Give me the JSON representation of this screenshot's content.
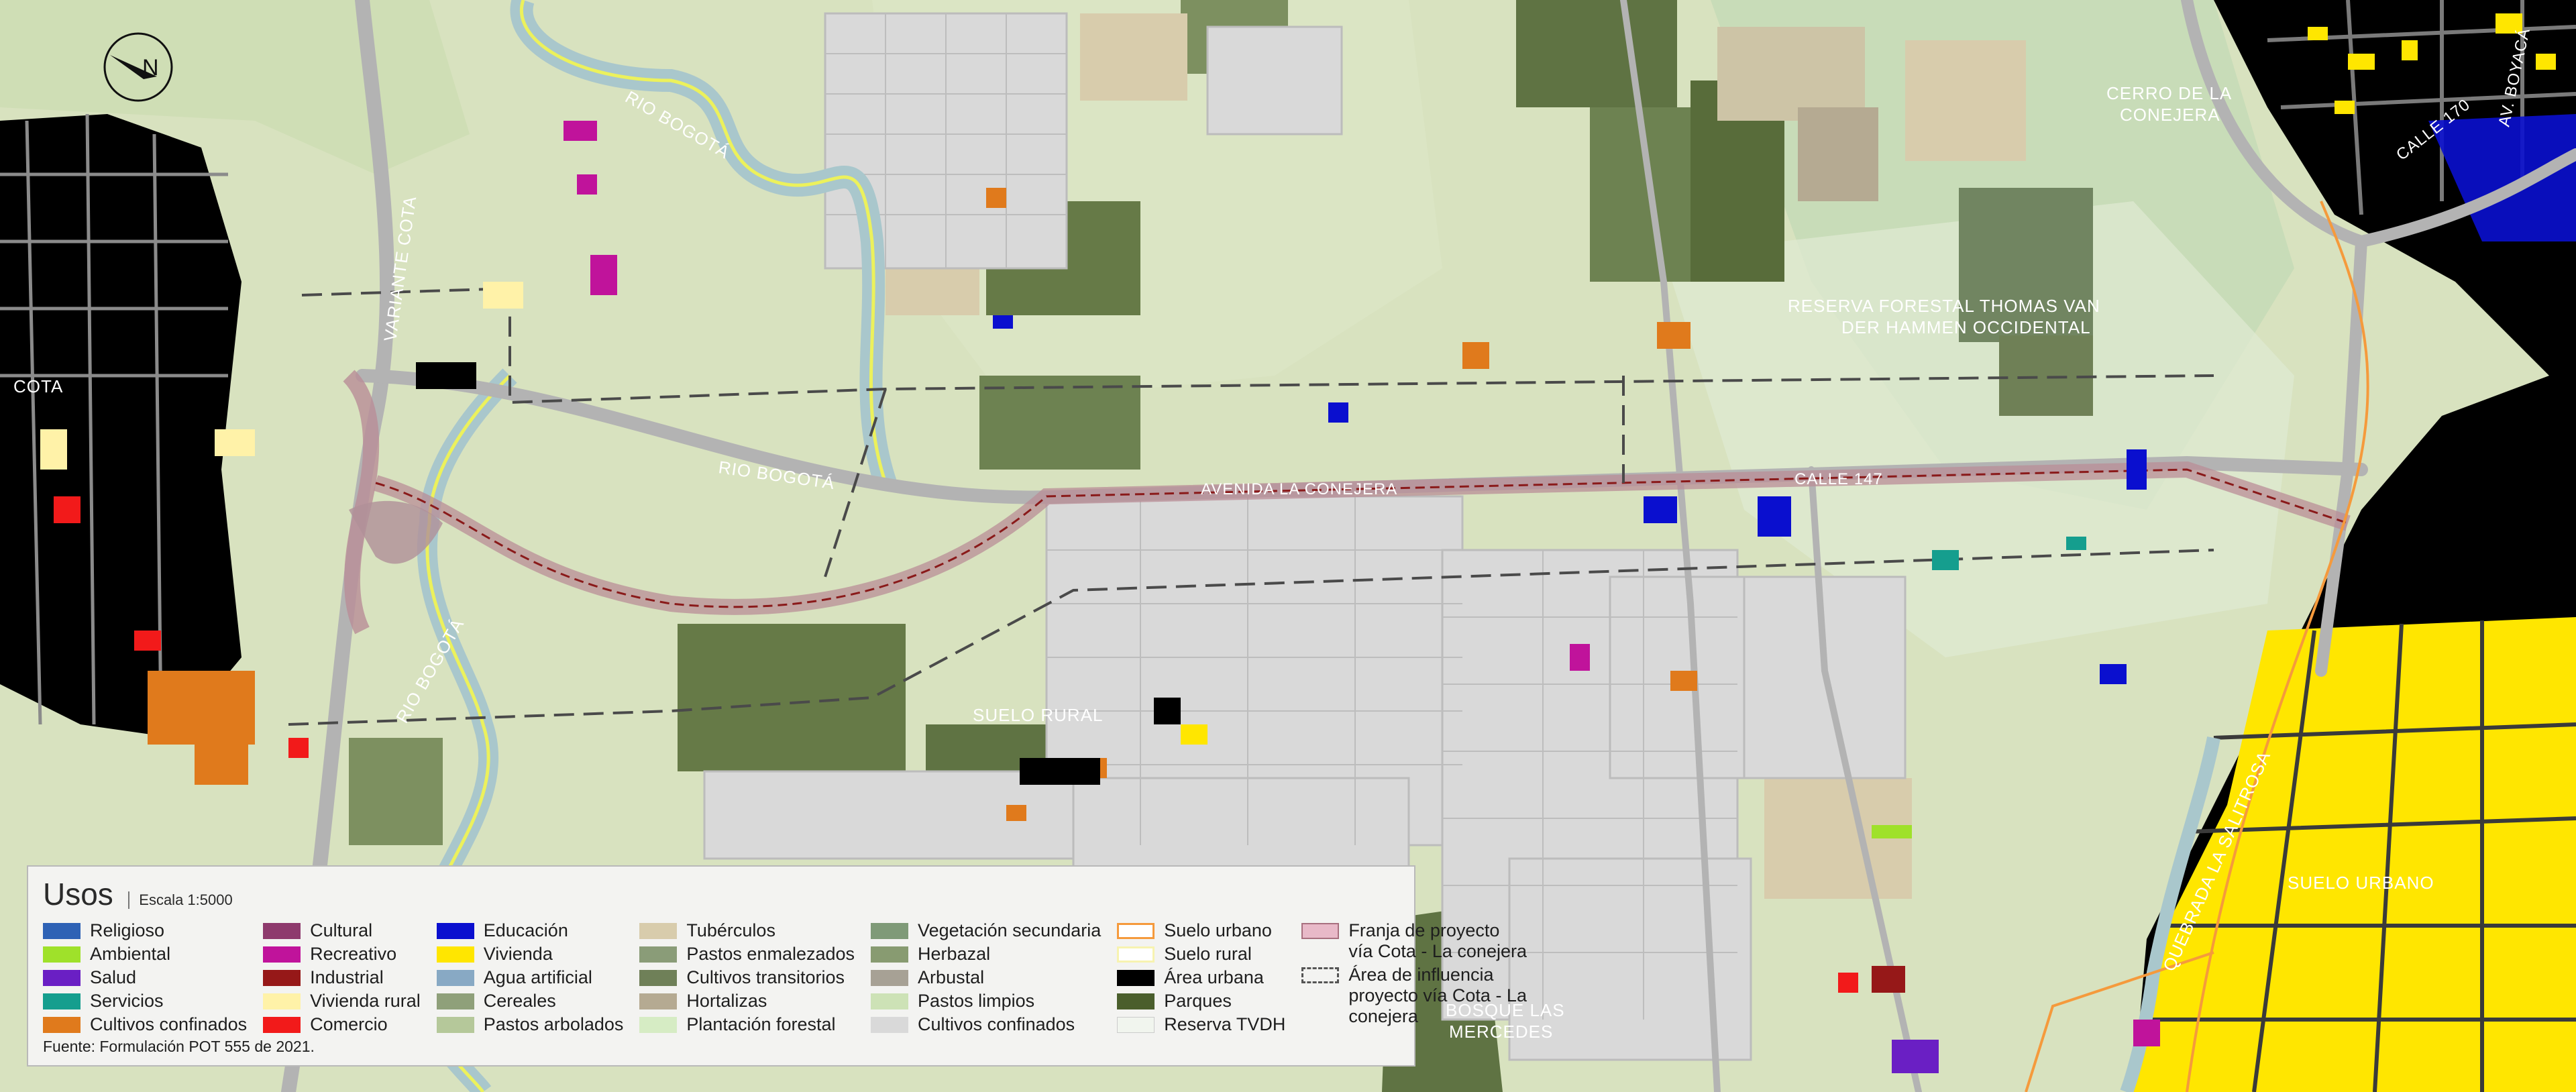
{
  "map_labels": {
    "rio_bogota_1": "RIO BOGOTÁ",
    "rio_bogota_2": "RIO BOGOTÁ",
    "rio_bogota_3": "RIO BOGOTÁ",
    "variante_cota": "VARIANTE COTA",
    "cota": "COTA",
    "avenida_la_conejera": "AVENIDA LA CONEJERA",
    "calle_147": "CALLE 147",
    "calle_170": "CALLE 170",
    "av_boyaca": "AV. BOYACÁ",
    "cerro_conejera_1": "CERRO DE LA",
    "cerro_conejera_2": "CONEJERA",
    "reserva_1": "RESERVA FORESTAL THOMAS VAN",
    "reserva_2": "DER HAMMEN OCCIDENTAL",
    "suelo_rural": "SUELO RURAL",
    "suelo_urbano": "SUELO URBANO",
    "quebrada": "QUEBRADA LA SALITROSA",
    "bosque_1": "BOSQUE LAS",
    "bosque_2": "MERCEDES",
    "north_letter": "N"
  },
  "legend": {
    "title": "Usos",
    "scale": "Escala 1:5000",
    "source": "Fuente: Formulación POT 555 de 2021.",
    "columns": [
      [
        {
          "label": "Religioso",
          "color": "#2e62b5"
        },
        {
          "label": "Ambiental",
          "color": "#9fe12a"
        },
        {
          "label": "Salud",
          "color": "#6a1fc4"
        },
        {
          "label": "Servicios",
          "color": "#159e8e"
        },
        {
          "label": "Cultivos confinados",
          "color": "#e07a1c"
        }
      ],
      [
        {
          "label": "Cultural",
          "color": "#8e3a6d"
        },
        {
          "label": "Recreativo",
          "color": "#c0139b"
        },
        {
          "label": "Industrial",
          "color": "#961818"
        },
        {
          "label": "Vivienda rural",
          "color": "#fff2a8"
        },
        {
          "label": "Comercio",
          "color": "#f21a1a"
        }
      ],
      [
        {
          "label": "Educación",
          "color": "#0a0fcf"
        },
        {
          "label": "Vivienda",
          "color": "#ffe600"
        },
        {
          "label": "Agua artificial",
          "color": "#88a9c4"
        },
        {
          "label": "Cereales",
          "color": "#8fa07a"
        },
        {
          "label": "Pastos arbolados",
          "color": "#b5c89a"
        }
      ],
      [
        {
          "label": "Tubérculos",
          "color": "#d8ccac"
        },
        {
          "label": "Pastos enmalezados",
          "color": "#8a9c78"
        },
        {
          "label": "Cultivos transitorios",
          "color": "#6f8058"
        },
        {
          "label": "Hortalizas",
          "color": "#b5aa92"
        },
        {
          "label": "Plantación forestal",
          "color": "#d6ecc4"
        }
      ],
      [
        {
          "label": "Vegetación secundaria",
          "color": "#7f9a78"
        },
        {
          "label": "Herbazal",
          "color": "#889b71"
        },
        {
          "label": "Arbustal",
          "color": "#a7a195"
        },
        {
          "label": "Pastos limpios",
          "color": "#cde2b6"
        },
        {
          "label": "Cultivos confinados",
          "color": "#d9d9d9"
        }
      ],
      [
        {
          "label": "Suelo urbano",
          "color": "#f59a3c",
          "style": "outline"
        },
        {
          "label": "Suelo rural",
          "color": "#f7f3b0",
          "style": "outline"
        },
        {
          "label": "Área urbana",
          "color": "#000000"
        },
        {
          "label": "Parques",
          "color": "#4a5e2c"
        },
        {
          "label": "Reserva TVDH",
          "color": "#f1f5ee"
        }
      ],
      [
        {
          "label": "Franja de proyecto\nvía Cota - La conejera",
          "color": "#e8b9c8",
          "style": "franja"
        },
        {
          "label": "Área de influencia\nproyecto vía Cota - La\nconejera",
          "color": "#555555",
          "style": "dashed"
        }
      ]
    ]
  }
}
